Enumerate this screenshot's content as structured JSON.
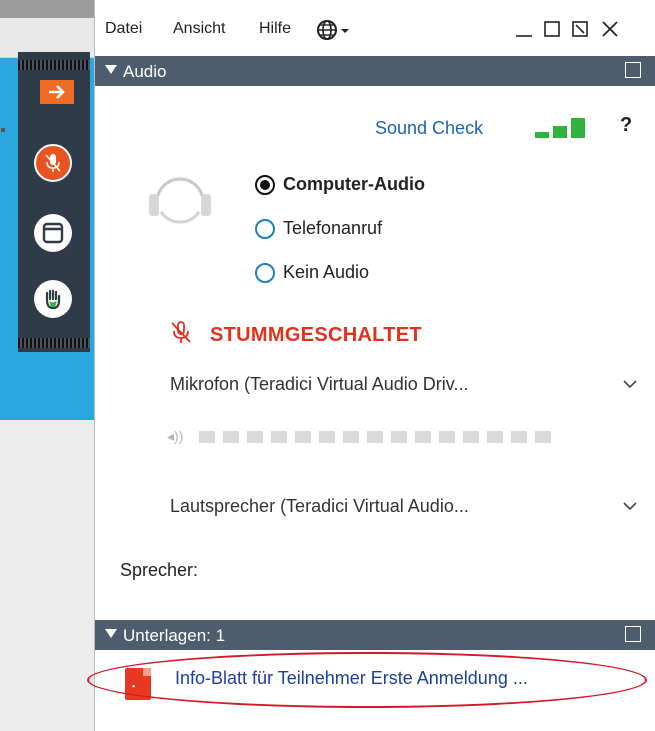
{
  "menu": {
    "datei": "Datei",
    "ansicht": "Ansicht",
    "hilfe": "Hilfe"
  },
  "audio_section": {
    "title": "Audio"
  },
  "sound_check": {
    "label": "Sound Check",
    "level_bars": 3
  },
  "help": {
    "label": "?"
  },
  "options": [
    {
      "label": "Computer-Audio",
      "selected": true
    },
    {
      "label": "Telefonanruf",
      "selected": false
    },
    {
      "label": "Kein Audio",
      "selected": false
    }
  ],
  "mute_status": {
    "label": "STUMMGESCHALTET"
  },
  "microphone": {
    "value": "Mikrofon (Teradici Virtual Audio Driv..."
  },
  "speaker": {
    "value": "Lautsprecher (Teradici Virtual Audio..."
  },
  "speaker_label": {
    "label": "Sprecher:"
  },
  "documents_section": {
    "title": "Unterlagen: 1"
  },
  "documents": [
    {
      "title": "Info-Blatt für Teilnehmer Erste Anmeldung ..."
    }
  ],
  "colors": {
    "section_bar": "#4e5d6e",
    "link_blue": "#1f63b3",
    "mute_red": "#e3311c",
    "meter_green": "#2fb33a",
    "highlight_oval": "#d01a2a",
    "side_blue": "#29a8e0",
    "toolbar_dark": "#2f3b48"
  }
}
